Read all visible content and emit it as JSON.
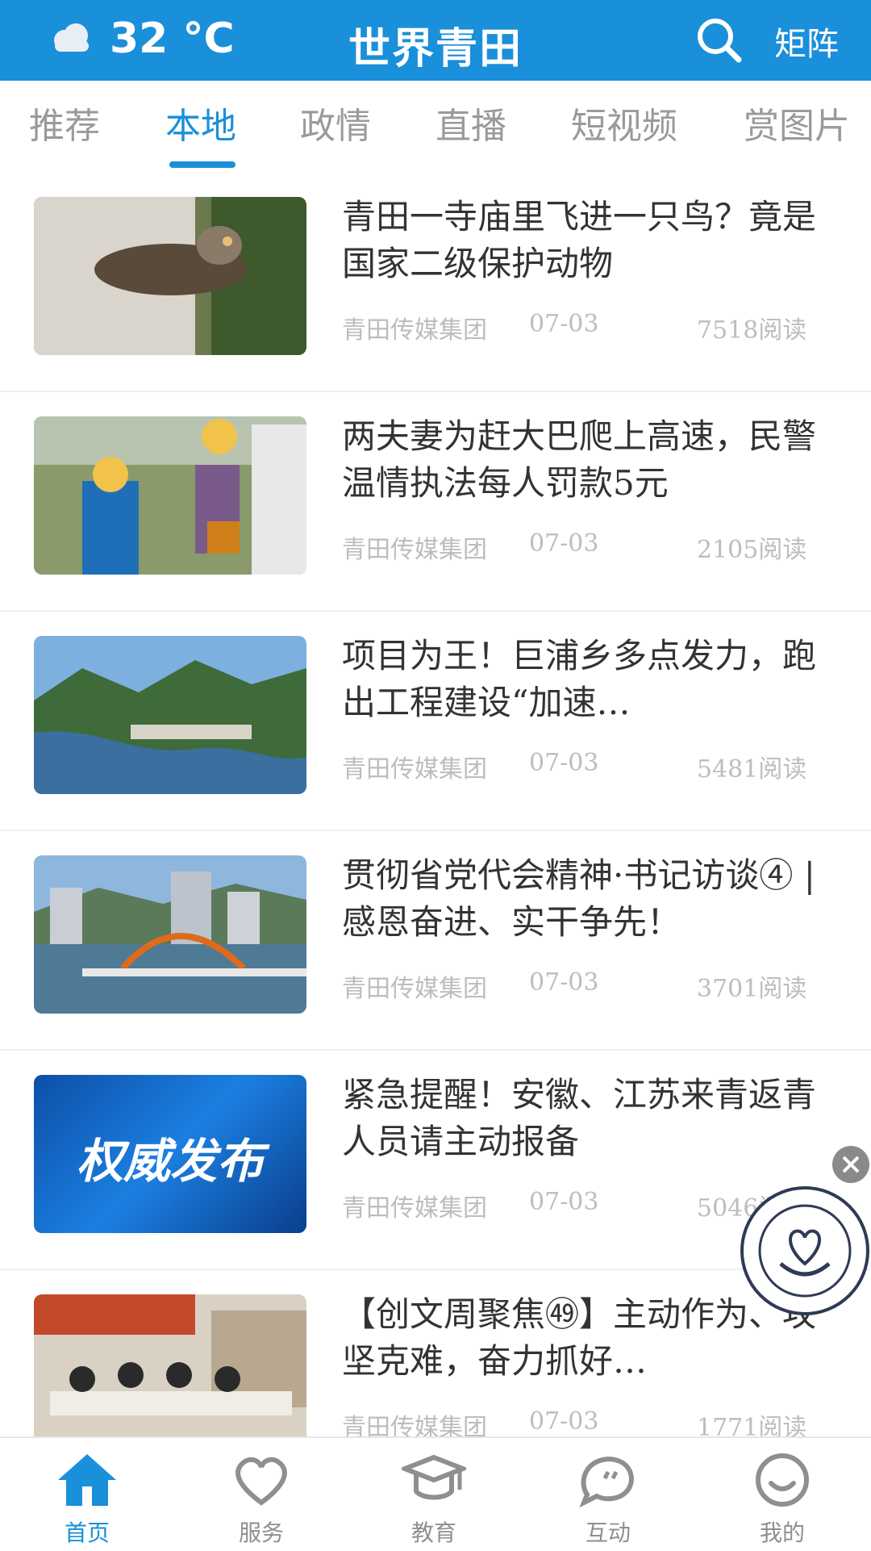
{
  "header": {
    "temperature": "32 °C",
    "title": "世界青田",
    "search_icon": "search-icon",
    "matrix_label": "矩阵",
    "weather_icon": "cloud-icon",
    "bg_color": "#1a8fda"
  },
  "tabs": [
    {
      "label": "推荐",
      "active": false
    },
    {
      "label": "本地",
      "active": true
    },
    {
      "label": "政情",
      "active": false
    },
    {
      "label": "直播",
      "active": false
    },
    {
      "label": "短视频",
      "active": false
    },
    {
      "label": "赏图片",
      "active": false
    }
  ],
  "articles": [
    {
      "title": "青田一寺庙里飞进一只鸟？竟是国家二级保护动物",
      "source": "青田传媒集团",
      "date": "07-03",
      "reads": "7518阅读"
    },
    {
      "title": "两夫妻为赶大巴爬上高速，民警温情执法每人罚款5元",
      "source": "青田传媒集团",
      "date": "07-03",
      "reads": "2105阅读"
    },
    {
      "title": "项目为王！巨浦乡多点发力，跑出工程建设“加速…",
      "source": "青田传媒集团",
      "date": "07-03",
      "reads": "5481阅读"
    },
    {
      "title": "贯彻省党代会精神·书记访谈④ | 感恩奋进、实干争先！",
      "source": "青田传媒集团",
      "date": "07-03",
      "reads": "3701阅读"
    },
    {
      "title": "紧急提醒！安徽、江苏来青返青人员请主动报备",
      "source": "青田传媒集团",
      "date": "07-03",
      "reads": "5046阅读",
      "thumb_text": "权威发布"
    },
    {
      "title": "【创文周聚焦㊾】主动作为、攻坚克难，奋力抓好…",
      "source": "青田传媒集团",
      "date": "07-03",
      "reads": "1771阅读"
    }
  ],
  "float_badge": {
    "close_icon": "close-icon",
    "logo": "foundation-logo"
  },
  "bottom_nav": [
    {
      "label": "首页",
      "icon": "home-icon",
      "active": true
    },
    {
      "label": "服务",
      "icon": "heart-icon",
      "active": false
    },
    {
      "label": "教育",
      "icon": "graduation-cap-icon",
      "active": false
    },
    {
      "label": "互动",
      "icon": "chat-bubble-icon",
      "active": false
    },
    {
      "label": "我的",
      "icon": "smiley-icon",
      "active": false
    }
  ]
}
